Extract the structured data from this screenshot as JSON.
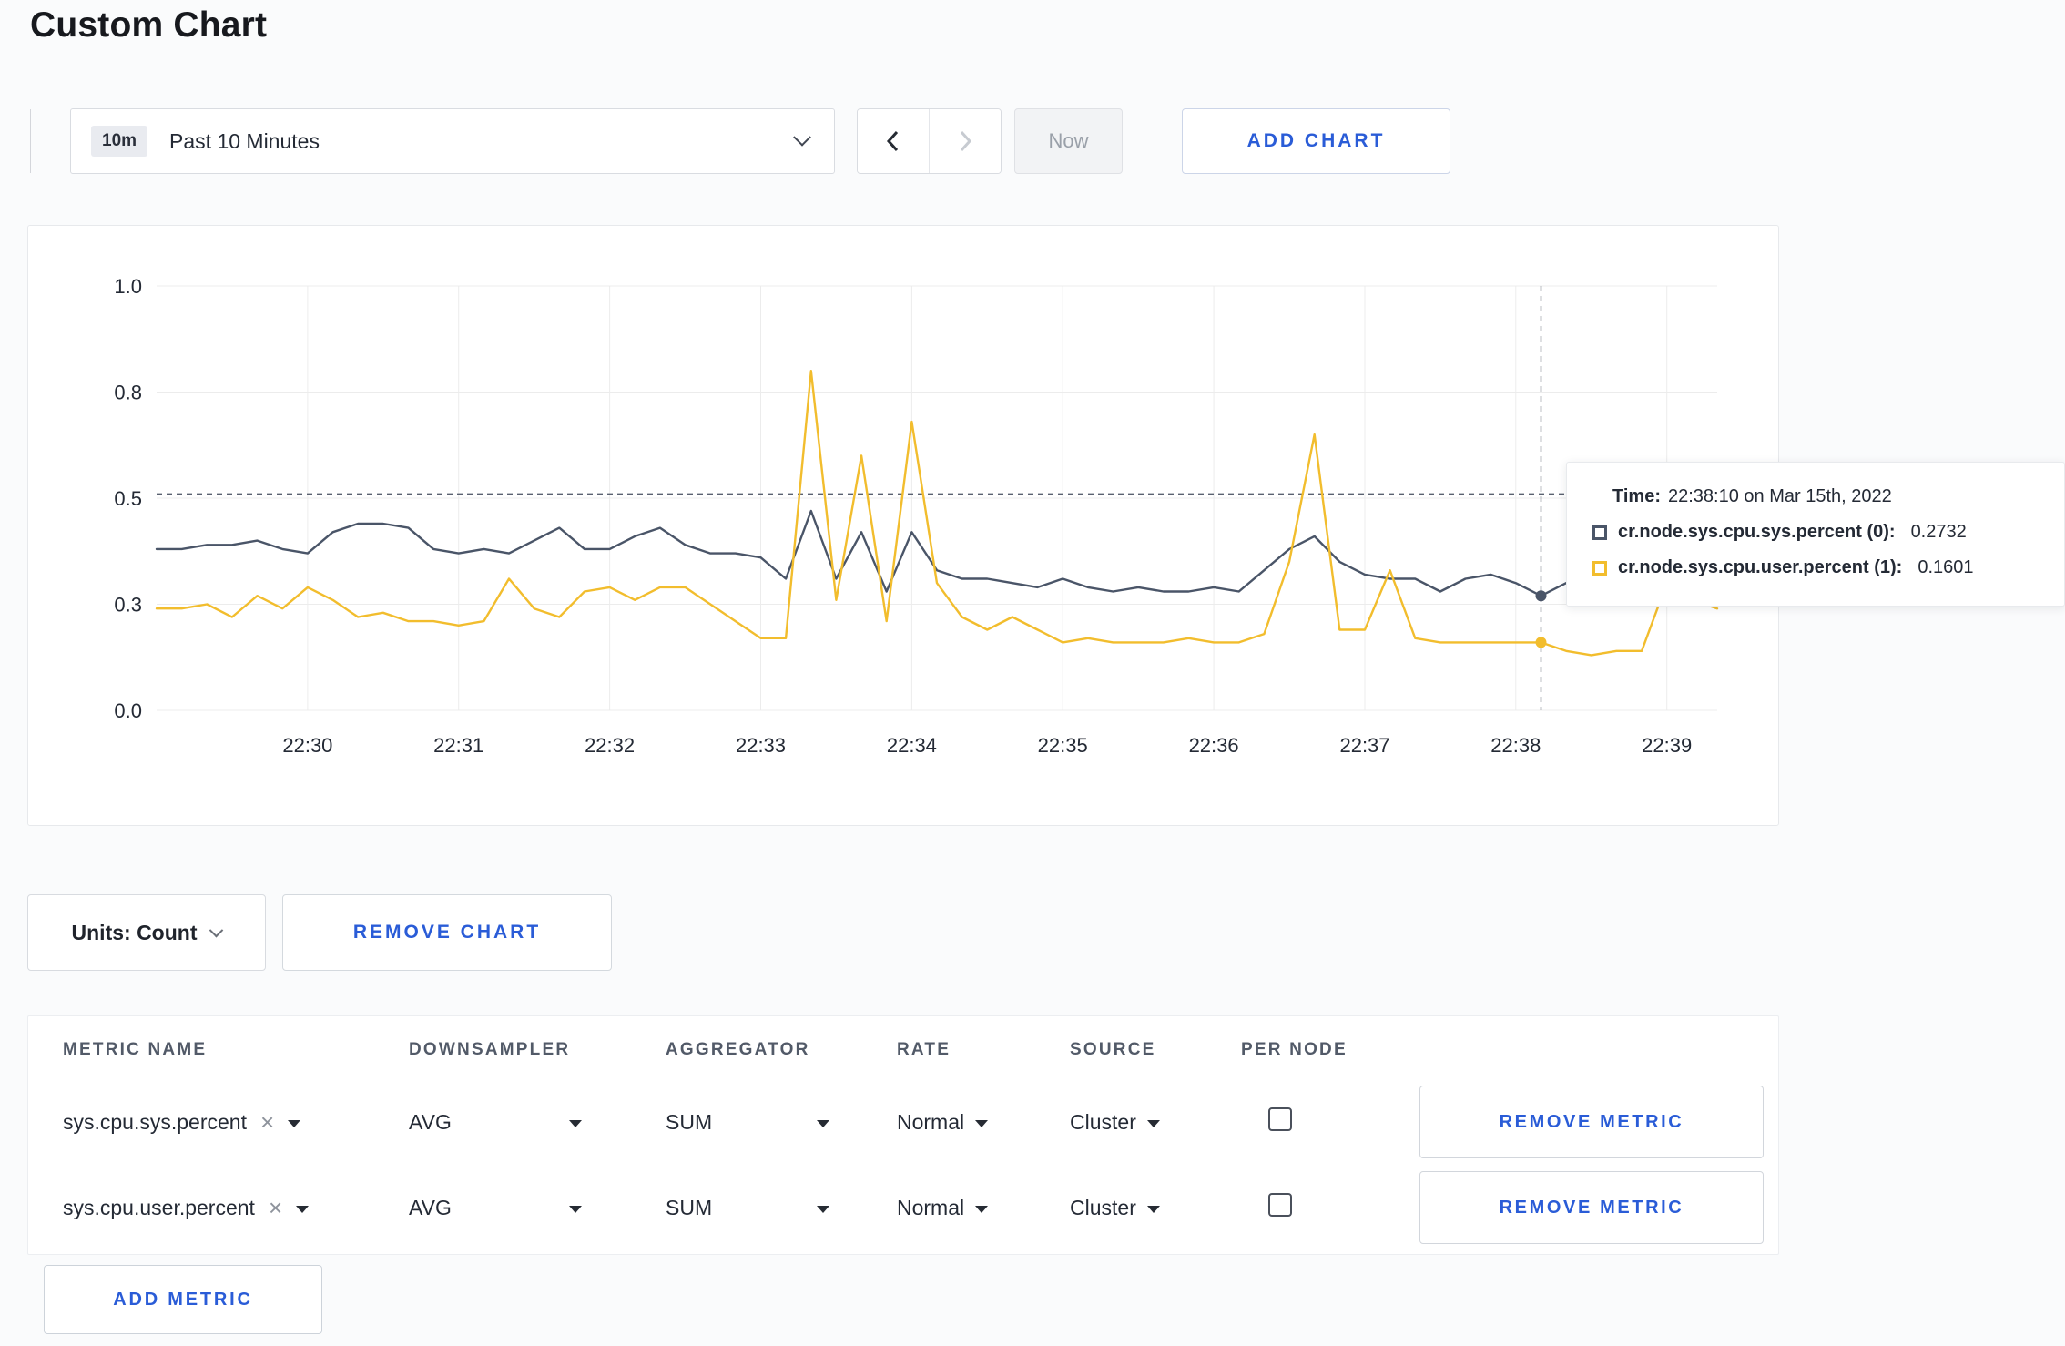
{
  "header": {
    "title": "Custom Chart"
  },
  "toolbar": {
    "time_range": {
      "badge": "10m",
      "label": "Past 10 Minutes"
    },
    "now_label": "Now",
    "add_chart_label": "ADD CHART"
  },
  "chart_data": {
    "type": "line",
    "title": "",
    "xlabel": "",
    "ylabel": "",
    "ylim": [
      0,
      1
    ],
    "grid": true,
    "point_count": 63,
    "y_ticks": [
      {
        "label": "0.0",
        "value": 0.0
      },
      {
        "label": "0.3",
        "value": 0.25
      },
      {
        "label": "0.5",
        "value": 0.5
      },
      {
        "label": "0.8",
        "value": 0.75
      },
      {
        "label": "1.0",
        "value": 1.0
      }
    ],
    "x_ticks": [
      {
        "label": "22:30",
        "index": 6
      },
      {
        "label": "22:31",
        "index": 12
      },
      {
        "label": "22:32",
        "index": 18
      },
      {
        "label": "22:33",
        "index": 24
      },
      {
        "label": "22:34",
        "index": 30
      },
      {
        "label": "22:35",
        "index": 36
      },
      {
        "label": "22:36",
        "index": 42
      },
      {
        "label": "22:37",
        "index": 48
      },
      {
        "label": "22:38",
        "index": 54
      },
      {
        "label": "22:39",
        "index": 60
      }
    ],
    "series": [
      {
        "name": "cr.node.sys.cpu.sys.percent",
        "color": "#4a5568",
        "values": [
          0.38,
          0.38,
          0.39,
          0.39,
          0.4,
          0.38,
          0.37,
          0.42,
          0.44,
          0.44,
          0.43,
          0.38,
          0.37,
          0.38,
          0.37,
          0.4,
          0.43,
          0.38,
          0.38,
          0.41,
          0.43,
          0.39,
          0.37,
          0.37,
          0.36,
          0.31,
          0.47,
          0.31,
          0.42,
          0.28,
          0.42,
          0.33,
          0.31,
          0.31,
          0.3,
          0.29,
          0.31,
          0.29,
          0.28,
          0.29,
          0.28,
          0.28,
          0.29,
          0.28,
          0.33,
          0.38,
          0.41,
          0.35,
          0.32,
          0.31,
          0.31,
          0.28,
          0.31,
          0.32,
          0.3,
          0.27,
          0.3,
          0.31,
          0.3,
          0.3,
          0.31,
          0.3,
          0.3
        ]
      },
      {
        "name": "cr.node.sys.cpu.user.percent",
        "color": "#f2bd2d",
        "values": [
          0.24,
          0.24,
          0.25,
          0.22,
          0.27,
          0.24,
          0.29,
          0.26,
          0.22,
          0.23,
          0.21,
          0.21,
          0.2,
          0.21,
          0.31,
          0.24,
          0.22,
          0.28,
          0.29,
          0.26,
          0.29,
          0.29,
          0.25,
          0.21,
          0.17,
          0.17,
          0.8,
          0.26,
          0.6,
          0.21,
          0.68,
          0.3,
          0.22,
          0.19,
          0.22,
          0.19,
          0.16,
          0.17,
          0.16,
          0.16,
          0.16,
          0.17,
          0.16,
          0.16,
          0.18,
          0.35,
          0.65,
          0.19,
          0.19,
          0.33,
          0.17,
          0.16,
          0.16,
          0.16,
          0.16,
          0.16,
          0.14,
          0.13,
          0.14,
          0.14,
          0.3,
          0.26,
          0.24
        ]
      }
    ],
    "crosshair": {
      "x_index": 55,
      "y_value": 0.51
    },
    "legend_position": "tooltip"
  },
  "tooltip": {
    "time_label": "Time:",
    "time_value": "22:38:10 on Mar 15th, 2022",
    "rows": [
      {
        "label": "cr.node.sys.cpu.sys.percent (0):",
        "value": "0.2732"
      },
      {
        "label": "cr.node.sys.cpu.user.percent (1):",
        "value": "0.1601"
      }
    ]
  },
  "chart_controls": {
    "units_label": "Units: Count",
    "remove_chart_label": "REMOVE CHART"
  },
  "metrics": {
    "columns": [
      "METRIC NAME",
      "DOWNSAMPLER",
      "AGGREGATOR",
      "RATE",
      "SOURCE",
      "PER NODE"
    ],
    "rows": [
      {
        "metric": "sys.cpu.sys.percent",
        "downsampler": "AVG",
        "aggregator": "SUM",
        "rate": "Normal",
        "source": "Cluster",
        "per_node": false,
        "remove_label": "REMOVE METRIC"
      },
      {
        "metric": "sys.cpu.user.percent",
        "downsampler": "AVG",
        "aggregator": "SUM",
        "rate": "Normal",
        "source": "Cluster",
        "per_node": false,
        "remove_label": "REMOVE METRIC"
      }
    ],
    "add_metric_label": "ADD METRIC"
  },
  "icons": {
    "clear": "×"
  },
  "colors": {
    "accent_blue": "#2a5cd7",
    "series_sys": "#4a5568",
    "series_user": "#f2bd2d",
    "grid": "#ececec",
    "crosshair": "#5a6170",
    "page_bg": "#fafbfc"
  }
}
